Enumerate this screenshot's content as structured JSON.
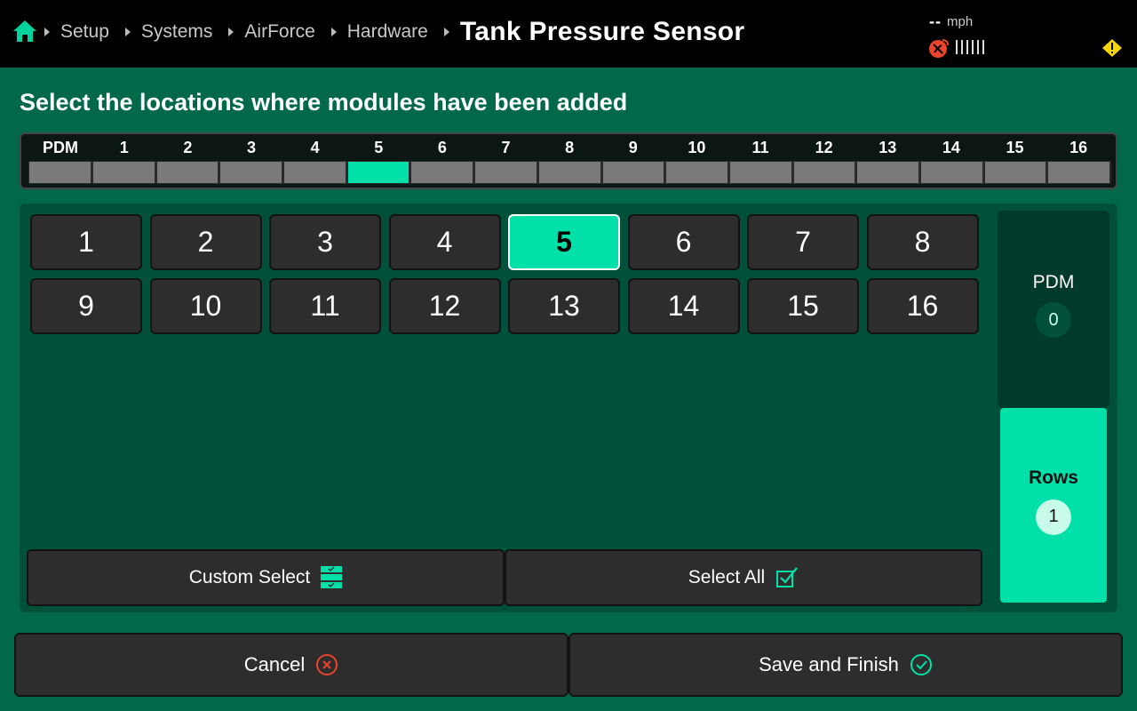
{
  "colors": {
    "accent": "#00e0a8",
    "header_bg": "#000000",
    "page_bg": "#01694a",
    "warning": "#f5d400",
    "alert_red": "#e8452c"
  },
  "header": {
    "breadcrumbs": [
      "Setup",
      "Systems",
      "AirForce",
      "Hardware"
    ],
    "title": "Tank Pressure Sensor",
    "speed_value": "--",
    "speed_unit": "mph"
  },
  "instruction": "Select the locations where modules have been added",
  "strip": {
    "labels": [
      "PDM",
      "1",
      "2",
      "3",
      "4",
      "5",
      "6",
      "7",
      "8",
      "9",
      "10",
      "11",
      "12",
      "13",
      "14",
      "15",
      "16"
    ],
    "active_index": 5
  },
  "grid": {
    "buttons": [
      "1",
      "2",
      "3",
      "4",
      "5",
      "6",
      "7",
      "8",
      "9",
      "10",
      "11",
      "12",
      "13",
      "14",
      "15",
      "16"
    ],
    "selected": "5"
  },
  "actions": {
    "custom_select": "Custom Select",
    "select_all": "Select All"
  },
  "side": {
    "pdm_label": "PDM",
    "pdm_count": "0",
    "rows_label": "Rows",
    "rows_count": "1"
  },
  "footer": {
    "cancel": "Cancel",
    "save": "Save and Finish"
  }
}
